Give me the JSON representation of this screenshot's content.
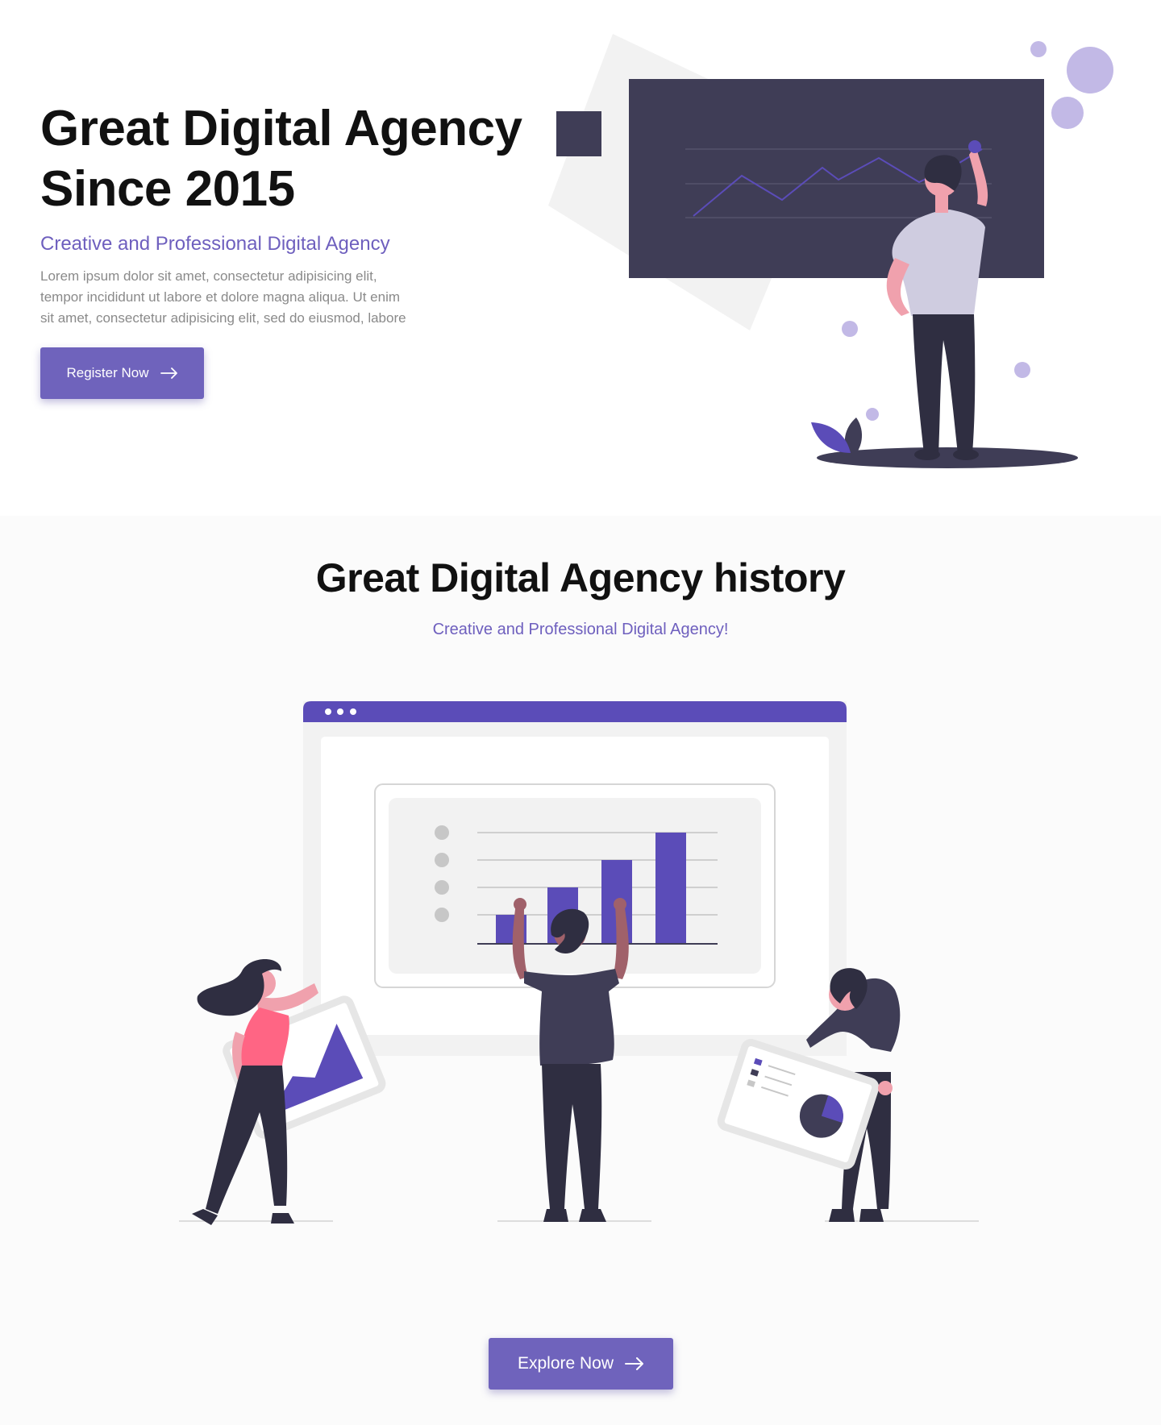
{
  "hero": {
    "title_line1": "Great Digital Agency",
    "title_line2": "Since 2015",
    "subtitle": "Creative and Professional Digital Agency",
    "text_lines": [
      "Lorem ipsum dolor sit amet, consectetur adipisicing elit,",
      "tempor incididunt ut labore et dolore magna aliqua. Ut enim",
      "sit amet, consectetur adipisicing elit, sed do eiusmod, labore"
    ],
    "register_label": "Register Now",
    "register_icon": "arrow-right-icon"
  },
  "history": {
    "title": "Great Digital Agency history",
    "subtitle": "Creative and Professional Digital Agency!",
    "explore_label": "Explore Now",
    "explore_icon": "arrow-right-icon"
  },
  "colors": {
    "accent": "#6f63bc",
    "accent_dark": "#5b4cb8",
    "dark": "#3f3d56",
    "light_purple": "#c2b9e6"
  }
}
